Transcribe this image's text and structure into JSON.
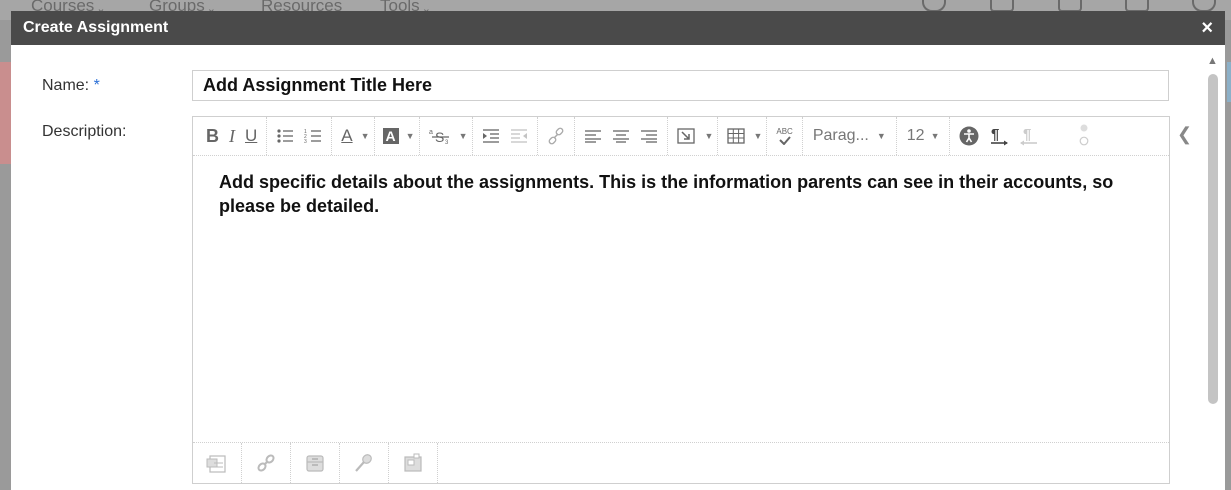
{
  "background_nav": {
    "items": [
      "Courses",
      "Groups",
      "Resources",
      "Tools"
    ]
  },
  "dialog": {
    "title": "Create Assignment",
    "close_symbol": "×"
  },
  "form": {
    "name_label": "Name:",
    "required_marker": "*",
    "name_value": "Add Assignment Title Here",
    "description_label": "Description:"
  },
  "editor": {
    "toolbar": {
      "bold": "B",
      "italic": "I",
      "underline": "U",
      "font_color": "A",
      "highlight": "A",
      "paragraph_select": "Parag...",
      "font_size": "12",
      "spellcheck": "ABC"
    },
    "content": "Add specific details about the assignments. This is the information parents can see in their accounts, so please be detailed."
  },
  "colors": {
    "header_bg": "#4a4a4a",
    "required": "#2a6fd6",
    "overlay": "#9a9a9a"
  }
}
